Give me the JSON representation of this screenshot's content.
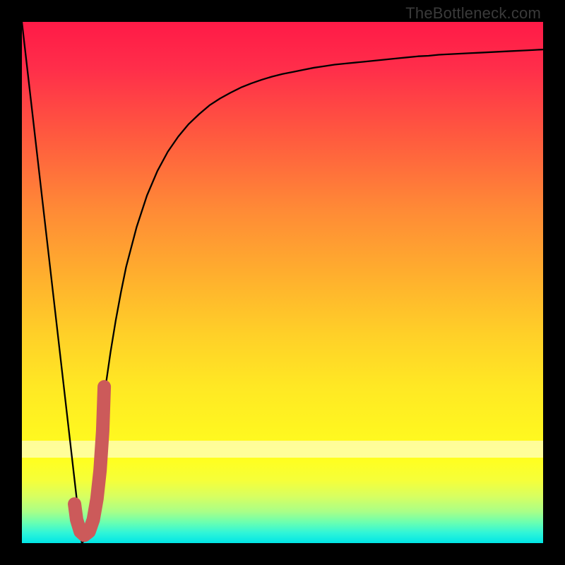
{
  "watermark": "TheBottleneck.com",
  "colors": {
    "frame": "#000000",
    "curve": "#000000",
    "mark": "#cc5a5a",
    "gradient_top": "#ff1a47",
    "gradient_bottom": "#00e6e6"
  },
  "chart_data": {
    "type": "line",
    "title": "",
    "xlabel": "",
    "ylabel": "",
    "xlim": [
      0,
      1
    ],
    "ylim": [
      0,
      1
    ],
    "x": [
      0.0,
      0.01,
      0.02,
      0.03,
      0.04,
      0.05,
      0.06,
      0.07,
      0.08,
      0.09,
      0.1,
      0.11,
      0.115,
      0.12,
      0.125,
      0.13,
      0.14,
      0.15,
      0.16,
      0.17,
      0.18,
      0.19,
      0.2,
      0.22,
      0.24,
      0.26,
      0.28,
      0.3,
      0.32,
      0.34,
      0.36,
      0.38,
      0.4,
      0.42,
      0.44,
      0.46,
      0.48,
      0.5,
      0.52,
      0.54,
      0.56,
      0.58,
      0.6,
      0.62,
      0.64,
      0.66,
      0.68,
      0.7,
      0.72,
      0.74,
      0.76,
      0.78,
      0.8,
      0.82,
      0.84,
      0.86,
      0.88,
      0.9,
      0.92,
      0.94,
      0.96,
      0.98,
      1.0
    ],
    "values": [
      1.0,
      0.913,
      0.826,
      0.739,
      0.652,
      0.565,
      0.478,
      0.391,
      0.304,
      0.217,
      0.13,
      0.043,
      0.0,
      0.005,
      0.02,
      0.05,
      0.135,
      0.22,
      0.297,
      0.366,
      0.427,
      0.481,
      0.53,
      0.606,
      0.667,
      0.714,
      0.751,
      0.78,
      0.804,
      0.823,
      0.84,
      0.853,
      0.864,
      0.874,
      0.882,
      0.889,
      0.895,
      0.9,
      0.904,
      0.908,
      0.912,
      0.915,
      0.918,
      0.92,
      0.922,
      0.924,
      0.926,
      0.928,
      0.93,
      0.932,
      0.934,
      0.935,
      0.937,
      0.938,
      0.939,
      0.94,
      0.941,
      0.942,
      0.943,
      0.944,
      0.945,
      0.946,
      0.947
    ],
    "highlight_mark": {
      "shape": "J",
      "x_range": [
        0.1,
        0.16
      ],
      "y_range": [
        0.0,
        0.3
      ]
    },
    "annotations": []
  }
}
